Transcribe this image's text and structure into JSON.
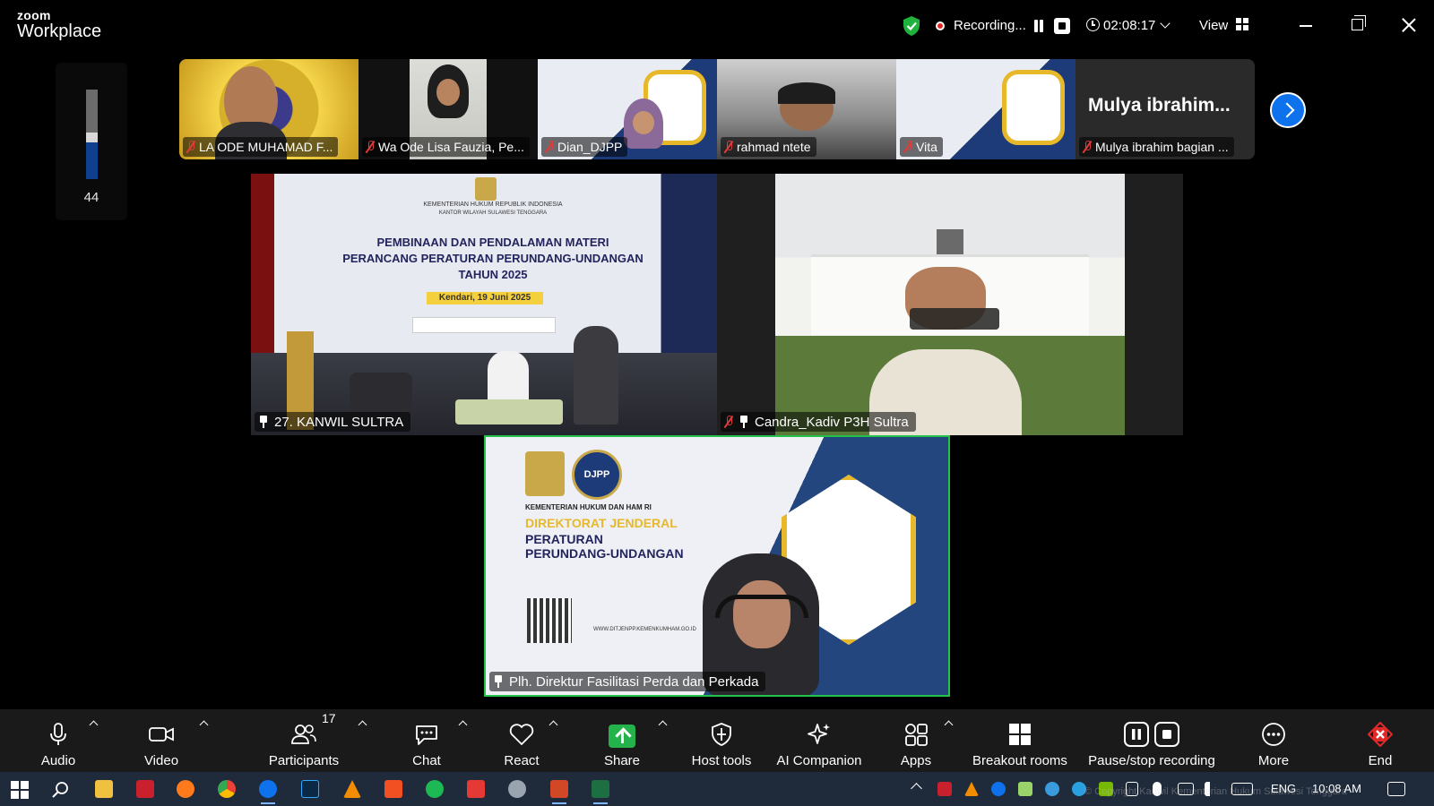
{
  "app": {
    "logo_line1": "zoom",
    "logo_line2": "Workplace"
  },
  "titlebar": {
    "recording_label": "Recording...",
    "elapsed_time": "02:08:17",
    "view_label": "View",
    "colors": {
      "shield": "#1fb33e",
      "record_dot": "#e02828"
    }
  },
  "audio_level": {
    "value": "44",
    "colors": {
      "bar": "#6b6b6b",
      "fill": "#0f3f8f",
      "marker": "#d8d8d8"
    }
  },
  "thumbnails": [
    {
      "name": "LA ODE MUHAMAD F...",
      "muted": true
    },
    {
      "name": "Wa Ode Lisa Fauzia, Pe...",
      "muted": true
    },
    {
      "name": "Dian_DJPP",
      "muted": true
    },
    {
      "name": "rahmad ntete",
      "muted": true
    },
    {
      "name": "Vita",
      "muted": true
    },
    {
      "name": "Mulya ibrahim bagian ...",
      "muted": true,
      "display_name": "Mulya  ibrahim..."
    }
  ],
  "main_tiles": {
    "tile_a": {
      "name": "27. KANWIL SULTRA",
      "banner": {
        "org_line1": "KEMENTERIAN HUKUM REPUBLIK INDONESIA",
        "org_line2": "KANTOR WILAYAH SULAWESI TENGGARA",
        "title_line1": "PEMBINAAN DAN PENDALAMAN MATERI",
        "title_line2": "PERANCANG PERATURAN PERUNDANG-UNDANGAN",
        "title_line3": "TAHUN 2025",
        "date": "Kendari, 19 Juni 2025"
      }
    },
    "tile_b": {
      "name": "Candra_Kadiv P3H Sultra",
      "muted": true
    },
    "tile_c": {
      "name": "Plh. Direktur Fasilitasi Perda dan Perkada",
      "active_speaker": true,
      "banner": {
        "badge": "DJPP",
        "org": "KEMENTERIAN HUKUM DAN HAM RI",
        "title_line1": "DIREKTORAT JENDERAL",
        "title_line2": "PERATURAN",
        "title_line3": "PERUNDANG-UNDANGAN",
        "url": "WWW.DITJENPP.KEMENKUMHAM.GO.ID"
      },
      "colors": {
        "border": "#24c24b"
      }
    }
  },
  "toolbar": {
    "audio": "Audio",
    "video": "Video",
    "participants": "Participants",
    "participants_count": "17",
    "chat": "Chat",
    "react": "React",
    "share": "Share",
    "host_tools": "Host tools",
    "ai_companion": "AI Companion",
    "apps": "Apps",
    "breakout_rooms": "Breakout rooms",
    "pause_stop_recording": "Pause/stop recording",
    "more": "More",
    "end": "End",
    "colors": {
      "share": "#24b24b",
      "end": "#e02828"
    }
  },
  "taskbar": {
    "language": "ENG",
    "clock": "10:08 AM",
    "watermark": "© Copyright Kanwil Kementerian Hukum Sulawesi Tenggara"
  }
}
